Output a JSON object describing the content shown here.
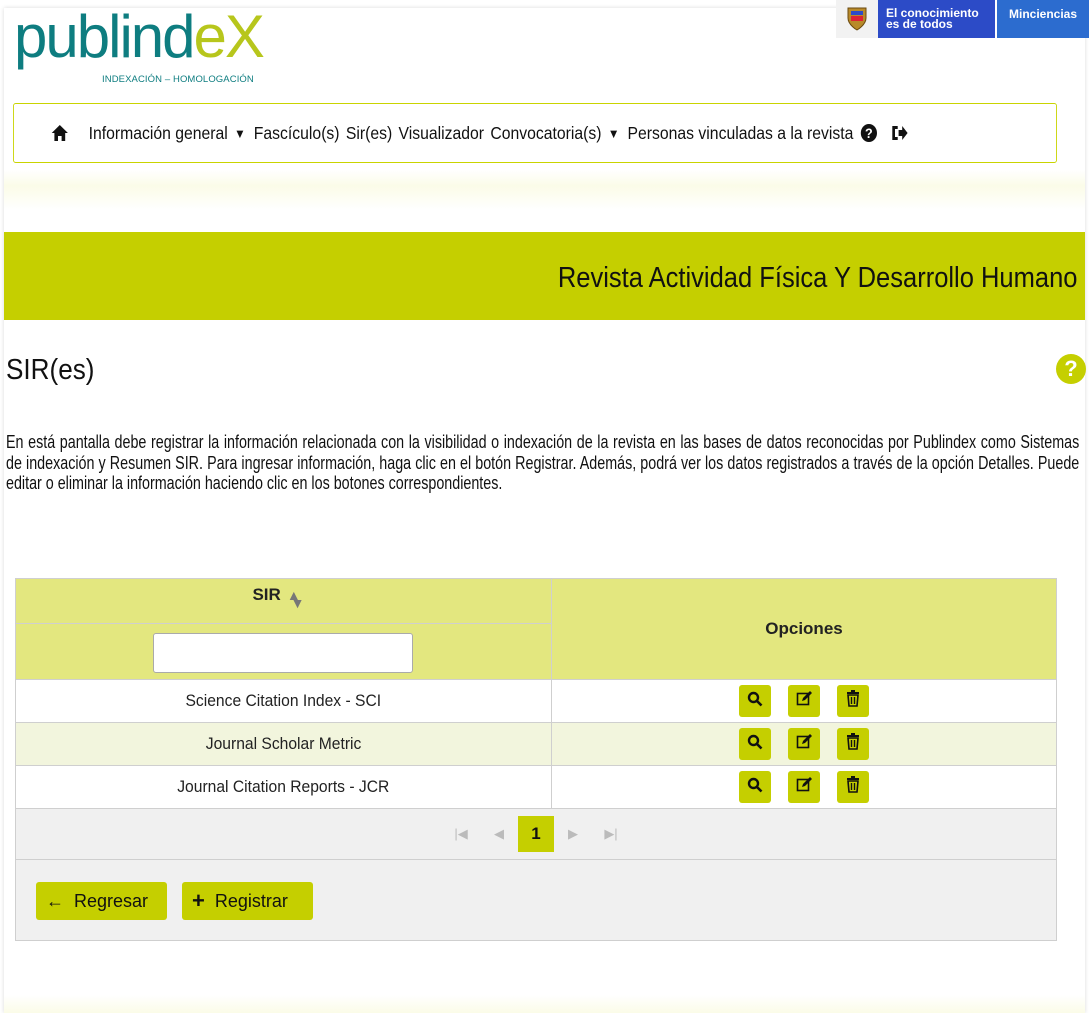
{
  "header": {
    "logo_word_main": "publind",
    "logo_word_accent": "eX",
    "logo_subtitle": "INDEXACIÓN – HOMOLOGACIÓN",
    "gov_line1": "El conocimiento",
    "gov_line2": "es de todos",
    "gov_ministry": "Minciencias"
  },
  "nav": {
    "items": [
      {
        "label": "Información general",
        "dropdown": true
      },
      {
        "label": "Fascículo(s)",
        "dropdown": false
      },
      {
        "label": "Sir(es)",
        "dropdown": false
      },
      {
        "label": "Visualizador",
        "dropdown": false
      },
      {
        "label": "Convocatoria(s)",
        "dropdown": true
      },
      {
        "label": "Personas vinculadas a la revista",
        "dropdown": false
      }
    ],
    "icons": [
      "home-icon",
      "help-circle-icon",
      "logout-icon"
    ]
  },
  "journal_title": "Revista Actividad Física Y Desarrollo Humano",
  "section_title": "SIR(es)",
  "intro": "En está pantalla debe registrar la información relacionada con la visibilidad o indexación de la revista en las bases de datos reconocidas por Publindex como Sistemas de indexación y Resumen SIR. Para ingresar información, haga clic en el botón Registrar. Además, podrá ver los datos registrados a través de la opción Detalles. Puede editar o eliminar la información haciendo clic en los botones correspondientes.",
  "table": {
    "col_sir": "SIR",
    "col_options": "Opciones",
    "filter_value": "",
    "rows": [
      {
        "sir": "Science Citation Index - SCI"
      },
      {
        "sir": "Journal Scholar Metric"
      },
      {
        "sir": "Journal Citation Reports - JCR"
      }
    ],
    "row_actions": [
      "search-icon",
      "edit-icon",
      "delete-icon"
    ]
  },
  "pagination": {
    "current_page": "1"
  },
  "buttons": {
    "back": "Regresar",
    "register": "Registrar"
  },
  "colors": {
    "accent": "#c5cf00",
    "header_row": "#e3e77f",
    "alt_row": "#f2f5dd",
    "logo_teal": "#0e7d80",
    "gov_blue": "#2c4bc7"
  }
}
